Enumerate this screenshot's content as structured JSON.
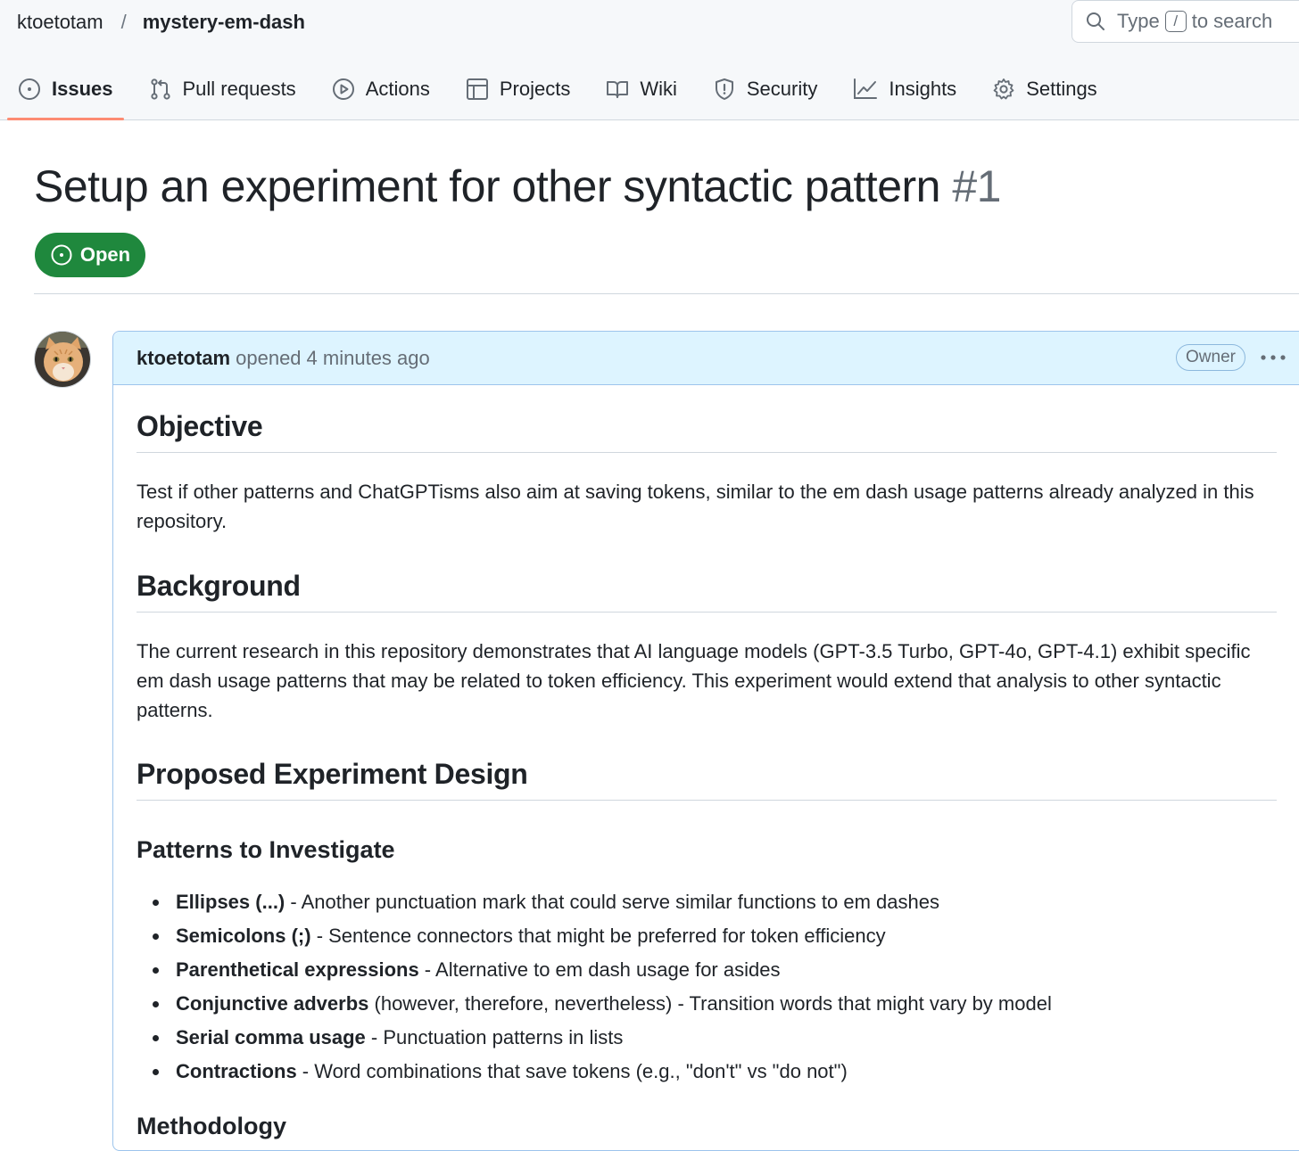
{
  "breadcrumb": {
    "owner": "ktoetotam",
    "separator": "/",
    "repo": "mystery-em-dash"
  },
  "search": {
    "prefix": "Type",
    "key": "/",
    "suffix": "to search"
  },
  "tabs": [
    {
      "label": "Issues",
      "icon": "issue-icon"
    },
    {
      "label": "Pull requests",
      "icon": "pull-request-icon"
    },
    {
      "label": "Actions",
      "icon": "play-icon"
    },
    {
      "label": "Projects",
      "icon": "table-icon"
    },
    {
      "label": "Wiki",
      "icon": "book-icon"
    },
    {
      "label": "Security",
      "icon": "shield-icon"
    },
    {
      "label": "Insights",
      "icon": "graph-icon"
    },
    {
      "label": "Settings",
      "icon": "gear-icon"
    }
  ],
  "issue": {
    "title": "Setup an experiment for other syntactic pattern",
    "number": "#1",
    "state": "Open"
  },
  "comment": {
    "author": "ktoetotam",
    "action": "opened",
    "time": "4 minutes ago",
    "role_badge": "Owner",
    "sections": {
      "objective_heading": "Objective",
      "objective_text": "Test if other patterns and ChatGPTisms also aim at saving tokens, similar to the em dash usage patterns already analyzed in this repository.",
      "background_heading": "Background",
      "background_text": "The current research in this repository demonstrates that AI language models (GPT-3.5 Turbo, GPT-4o, GPT-4.1) exhibit specific em dash usage patterns that may be related to token efficiency. This experiment would extend that analysis to other syntactic patterns.",
      "design_heading": "Proposed Experiment Design",
      "patterns_heading": "Patterns to Investigate",
      "next_heading": "Methodology"
    },
    "patterns": [
      {
        "term": "Ellipses (...)",
        "desc": " - Another punctuation mark that could serve similar functions to em dashes"
      },
      {
        "term": "Semicolons (;)",
        "desc": " - Sentence connectors that might be preferred for token efficiency"
      },
      {
        "term": "Parenthetical expressions",
        "desc": " - Alternative to em dash usage for asides"
      },
      {
        "term": "Conjunctive adverbs",
        "desc": " (however, therefore, nevertheless) - Transition words that might vary by model"
      },
      {
        "term": "Serial comma usage",
        "desc": " - Punctuation patterns in lists"
      },
      {
        "term": "Contractions",
        "desc": " - Word combinations that save tokens (e.g., \"don't\" vs \"do not\")"
      }
    ]
  },
  "colors": {
    "open_green": "#1f883d",
    "active_tab_underline": "#fd8c73",
    "comment_header_bg": "#ddf4ff",
    "comment_border": "#9dc4ec"
  }
}
